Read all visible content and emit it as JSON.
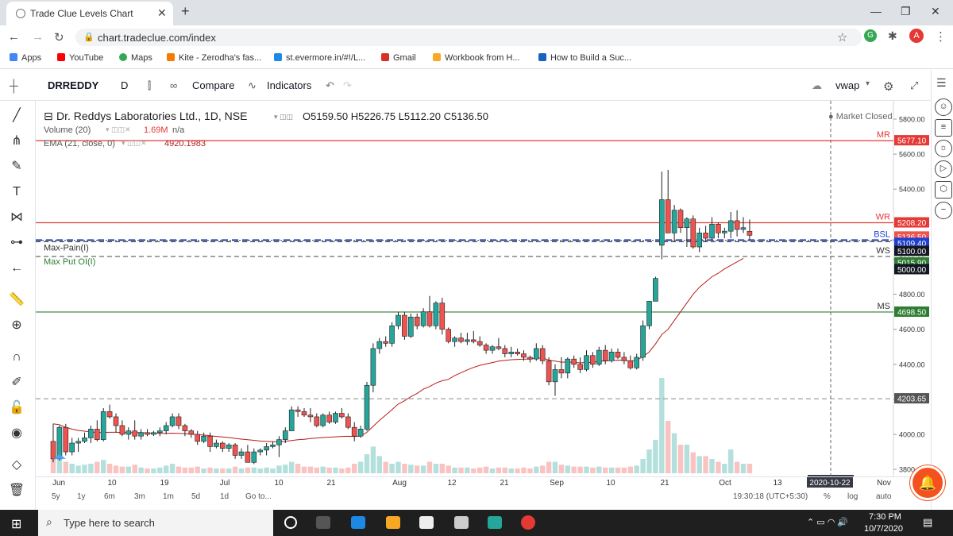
{
  "browser": {
    "tab_title": "Trade Clue Levels Chart",
    "url": "chart.tradeclue.com/index",
    "profile_initial": "A",
    "bookmarks": [
      "Apps",
      "YouTube",
      "Maps",
      "Kite - Zerodha's fas...",
      "st.evermore.in/#!/L...",
      "Gmail",
      "Workbook from H...",
      "How to Build a Suc..."
    ]
  },
  "toolbar": {
    "symbol": "DRREDDY",
    "interval": "D",
    "compare_label": "Compare",
    "indicators_label": "Indicators",
    "vwap_label": "vwap"
  },
  "legend": {
    "title": "Dr. Reddys Laboratories Ltd., 1D, NSE",
    "ohlc": "O5159.50 H5226.75 L5112.20 C5136.50",
    "volume_label": "Volume (20)",
    "volume_value": "1.69M",
    "volume_na": "n/a",
    "ema_label": "EMA (21, close, 0)",
    "ema_value": "4920.1983",
    "market_status": "Market Closed"
  },
  "time_nav": {
    "ranges": [
      "5y",
      "1y",
      "6m",
      "3m",
      "1m",
      "5d",
      "1d"
    ],
    "goto": "Go to...",
    "clock": "19:30:18 (UTC+5:30)",
    "pct": "%",
    "log": "log",
    "auto": "auto"
  },
  "taskbar": {
    "search_placeholder": "Type here to search",
    "time": "7:30 PM",
    "date": "10/7/2020"
  },
  "colors": {
    "up": "#26a69a",
    "down": "#ef5350",
    "resistance": "#e53935",
    "support": "#2e7d32",
    "ema": "#b71c1c",
    "blue_dash": "#1e3fcf"
  },
  "chart_data": {
    "type": "candlestick",
    "y_axis_ticks": [
      3800,
      4000,
      4200,
      4400,
      4600,
      4800,
      5000,
      5200,
      5400,
      5600,
      5800
    ],
    "x_axis_labels": [
      "Jun",
      "10",
      "19",
      "Jul",
      "10",
      "21",
      "Aug",
      "12",
      "21",
      "Sep",
      "10",
      "21",
      "Oct",
      "13",
      "2020-10-22",
      "Nov"
    ],
    "price_labels": {
      "MR": "5677.10",
      "WR": "5208.20",
      "close": "5136.50",
      "BSL": "5109.40",
      "line_5100": "5100.00",
      "WS": "5015.90",
      "line_5000": "5000.00",
      "MS": "4698.50",
      "gray": "4203.65"
    },
    "level_names": {
      "mr": "MR",
      "wr": "WR",
      "bsl": "BSL",
      "ws": "WS",
      "ms": "MS"
    },
    "line_labels": {
      "max_pain": "Max-Pain(I)",
      "max_put": "Max Put OI(I)"
    },
    "candles": [
      [
        3960,
        4060,
        3840,
        3860
      ],
      [
        3860,
        4050,
        3850,
        4040
      ],
      [
        4040,
        4060,
        3880,
        3900
      ],
      [
        3900,
        3980,
        3880,
        3950
      ],
      [
        3950,
        3980,
        3900,
        3960
      ],
      [
        3960,
        4010,
        3950,
        3980
      ],
      [
        3980,
        4050,
        3950,
        4030
      ],
      [
        4030,
        4080,
        3960,
        3970
      ],
      [
        3970,
        4150,
        3960,
        4130
      ],
      [
        4130,
        4170,
        4090,
        4100
      ],
      [
        4100,
        4120,
        4010,
        4050
      ],
      [
        4050,
        4080,
        3990,
        4000
      ],
      [
        4000,
        4040,
        3970,
        4020
      ],
      [
        4020,
        4080,
        3970,
        3990
      ],
      [
        3990,
        4030,
        3970,
        4010
      ],
      [
        4010,
        4030,
        3990,
        4000
      ],
      [
        4000,
        4020,
        3990,
        4010
      ],
      [
        4010,
        4040,
        3990,
        4020
      ],
      [
        4020,
        4070,
        4000,
        4050
      ],
      [
        4050,
        4120,
        4040,
        4100
      ],
      [
        4100,
        4120,
        4030,
        4050
      ],
      [
        4050,
        4060,
        3990,
        4020
      ],
      [
        4020,
        4030,
        3980,
        4000
      ],
      [
        4000,
        4020,
        3940,
        3960
      ],
      [
        3960,
        4010,
        3950,
        3990
      ],
      [
        3990,
        4010,
        3900,
        3930
      ],
      [
        3930,
        3970,
        3920,
        3950
      ],
      [
        3950,
        3960,
        3900,
        3920
      ],
      [
        3920,
        3950,
        3900,
        3940
      ],
      [
        3940,
        3950,
        3860,
        3880
      ],
      [
        3880,
        3920,
        3860,
        3900
      ],
      [
        3900,
        3940,
        3840,
        3840
      ],
      [
        3840,
        3920,
        3830,
        3900
      ],
      [
        3900,
        3920,
        3880,
        3910
      ],
      [
        3910,
        3950,
        3880,
        3930
      ],
      [
        3930,
        3960,
        3920,
        3940
      ],
      [
        3940,
        3990,
        3870,
        3970
      ],
      [
        3970,
        4040,
        3950,
        4020
      ],
      [
        4020,
        4160,
        4020,
        4140
      ],
      [
        4140,
        4160,
        4100,
        4130
      ],
      [
        4130,
        4150,
        4100,
        4110
      ],
      [
        4110,
        4150,
        4070,
        4100
      ],
      [
        4100,
        4120,
        4040,
        4050
      ],
      [
        4050,
        4120,
        4040,
        4110
      ],
      [
        4110,
        4130,
        4060,
        4070
      ],
      [
        4070,
        4130,
        4060,
        4120
      ],
      [
        4120,
        4150,
        4090,
        4100
      ],
      [
        4100,
        4120,
        4030,
        4040
      ],
      [
        4040,
        4070,
        3960,
        3990
      ],
      [
        3990,
        4050,
        3980,
        4030
      ],
      [
        4030,
        4300,
        4020,
        4280
      ],
      [
        4280,
        4520,
        4240,
        4490
      ],
      [
        4490,
        4550,
        4460,
        4530
      ],
      [
        4530,
        4560,
        4500,
        4520
      ],
      [
        4520,
        4640,
        4500,
        4620
      ],
      [
        4620,
        4700,
        4600,
        4680
      ],
      [
        4680,
        4700,
        4540,
        4560
      ],
      [
        4560,
        4690,
        4550,
        4670
      ],
      [
        4670,
        4690,
        4600,
        4620
      ],
      [
        4620,
        4720,
        4610,
        4700
      ],
      [
        4700,
        4790,
        4610,
        4620
      ],
      [
        4620,
        4760,
        4600,
        4750
      ],
      [
        4750,
        4780,
        4570,
        4600
      ],
      [
        4600,
        4610,
        4520,
        4530
      ],
      [
        4530,
        4560,
        4500,
        4550
      ],
      [
        4550,
        4580,
        4520,
        4530
      ],
      [
        4530,
        4580,
        4510,
        4540
      ],
      [
        4540,
        4590,
        4520,
        4530
      ],
      [
        4530,
        4560,
        4500,
        4510
      ],
      [
        4510,
        4520,
        4460,
        4480
      ],
      [
        4480,
        4510,
        4460,
        4500
      ],
      [
        4500,
        4550,
        4480,
        4490
      ],
      [
        4490,
        4510,
        4440,
        4460
      ],
      [
        4460,
        4500,
        4440,
        4470
      ],
      [
        4470,
        4490,
        4450,
        4460
      ],
      [
        4460,
        4480,
        4420,
        4440
      ],
      [
        4440,
        4450,
        4410,
        4430
      ],
      [
        4430,
        4520,
        4420,
        4490
      ],
      [
        4490,
        4510,
        4400,
        4420
      ],
      [
        4420,
        4440,
        4280,
        4300
      ],
      [
        4300,
        4400,
        4220,
        4370
      ],
      [
        4370,
        4440,
        4320,
        4350
      ],
      [
        4350,
        4440,
        4320,
        4430
      ],
      [
        4430,
        4450,
        4380,
        4400
      ],
      [
        4400,
        4440,
        4350,
        4370
      ],
      [
        4370,
        4480,
        4360,
        4450
      ],
      [
        4450,
        4470,
        4380,
        4400
      ],
      [
        4400,
        4500,
        4390,
        4480
      ],
      [
        4480,
        4510,
        4400,
        4420
      ],
      [
        4420,
        4490,
        4410,
        4470
      ],
      [
        4470,
        4490,
        4430,
        4440
      ],
      [
        4440,
        4470,
        4400,
        4420
      ],
      [
        4420,
        4450,
        4370,
        4380
      ],
      [
        4380,
        4460,
        4370,
        4440
      ],
      [
        4440,
        4650,
        4420,
        4620
      ],
      [
        4620,
        4760,
        4600,
        4760
      ],
      [
        4760,
        4900,
        4760,
        4890
      ],
      [
        5080,
        5500,
        5000,
        5340
      ],
      [
        5340,
        5510,
        5200,
        5150
      ],
      [
        5150,
        5310,
        5100,
        5280
      ],
      [
        5280,
        5290,
        5150,
        5180
      ],
      [
        5180,
        5240,
        5070,
        5230
      ],
      [
        5230,
        5250,
        5060,
        5070
      ],
      [
        5070,
        5180,
        5040,
        5150
      ],
      [
        5150,
        5190,
        5100,
        5120
      ],
      [
        5120,
        5240,
        5110,
        5200
      ],
      [
        5200,
        5210,
        5120,
        5150
      ],
      [
        5150,
        5180,
        5120,
        5160
      ],
      [
        5160,
        5270,
        5120,
        5220
      ],
      [
        5220,
        5280,
        5130,
        5170
      ],
      [
        5170,
        5240,
        5150,
        5180
      ],
      [
        5159.5,
        5226.75,
        5112.2,
        5136.5
      ]
    ],
    "volume_rel": [
      0.15,
      0.2,
      0.12,
      0.1,
      0.08,
      0.09,
      0.1,
      0.12,
      0.14,
      0.1,
      0.08,
      0.07,
      0.07,
      0.09,
      0.06,
      0.05,
      0.05,
      0.06,
      0.08,
      0.1,
      0.07,
      0.06,
      0.06,
      0.07,
      0.05,
      0.06,
      0.05,
      0.05,
      0.05,
      0.07,
      0.05,
      0.06,
      0.06,
      0.05,
      0.06,
      0.05,
      0.08,
      0.09,
      0.12,
      0.1,
      0.07,
      0.07,
      0.06,
      0.07,
      0.06,
      0.06,
      0.05,
      0.06,
      0.1,
      0.12,
      0.2,
      0.28,
      0.18,
      0.12,
      0.1,
      0.12,
      0.1,
      0.09,
      0.08,
      0.08,
      0.12,
      0.1,
      0.1,
      0.08,
      0.06,
      0.06,
      0.06,
      0.05,
      0.06,
      0.07,
      0.05,
      0.06,
      0.06,
      0.05,
      0.05,
      0.06,
      0.05,
      0.07,
      0.08,
      0.12,
      0.12,
      0.09,
      0.08,
      0.07,
      0.07,
      0.07,
      0.06,
      0.07,
      0.06,
      0.06,
      0.06,
      0.06,
      0.07,
      0.08,
      0.15,
      0.25,
      0.35,
      1.0,
      0.55,
      0.42,
      0.3,
      0.3,
      0.22,
      0.18,
      0.18,
      0.15,
      0.12,
      0.1,
      0.25,
      0.12,
      0.1,
      0.1
    ],
    "ema": [
      4060,
      4055,
      4040,
      4030,
      4022,
      4018,
      4014,
      4010,
      4011,
      4012,
      4012,
      4011,
      4010,
      4010,
      4010,
      4008,
      4007,
      4006,
      4006,
      4007,
      4006,
      4004,
      4001,
      3998,
      3996,
      3992,
      3988,
      3985,
      3982,
      3977,
      3973,
      3969,
      3966,
      3962,
      3960,
      3958,
      3958,
      3960,
      3965,
      3969,
      3972,
      3976,
      3979,
      3982,
      3984,
      3986,
      3988,
      3989,
      3988,
      3990,
      4012,
      4046,
      4080,
      4110,
      4141,
      4173,
      4192,
      4215,
      4234,
      4258,
      4273,
      4293,
      4306,
      4314,
      4336,
      4352,
      4368,
      4382,
      4394,
      4402,
      4410,
      4418,
      4422,
      4426,
      4428,
      4430,
      4430,
      4435,
      4436,
      4424,
      4418,
      4412,
      4413,
      4411,
      4408,
      4411,
      4410,
      4419,
      4419,
      4423,
      4424,
      4423,
      4419,
      4423,
      4444,
      4471,
      4516,
      4570,
      4600,
      4650,
      4700,
      4750,
      4800,
      4840,
      4870,
      4900,
      4920,
      4945,
      4965,
      4985,
      5005
    ]
  }
}
